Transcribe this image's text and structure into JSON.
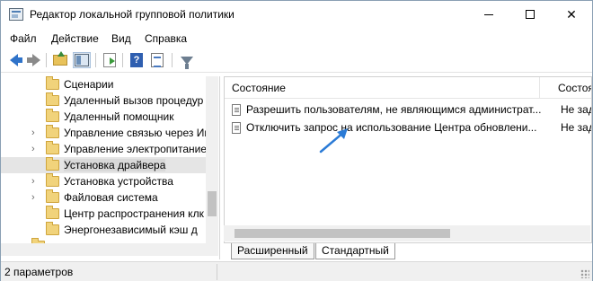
{
  "window": {
    "title": "Редактор локальной групповой политики",
    "min_glyph": "",
    "close_glyph": "✕"
  },
  "menu": {
    "items": [
      "Файл",
      "Действие",
      "Вид",
      "Справка"
    ]
  },
  "toolbar": {
    "icons": [
      "back-icon",
      "forward-icon",
      "up-folder-icon",
      "show-hide-tree-icon",
      "export-list-icon",
      "help-icon",
      "properties-icon",
      "filter-icon"
    ],
    "help_glyph": "?"
  },
  "tree": {
    "items": [
      {
        "label": "Сценарии",
        "expandable": false,
        "selected": false
      },
      {
        "label": "Удаленный вызов процедур",
        "expandable": false,
        "selected": false
      },
      {
        "label": "Удаленный помощник",
        "expandable": false,
        "selected": false
      },
      {
        "label": "Управление связью через Инт",
        "expandable": true,
        "selected": false
      },
      {
        "label": "Управление электропитание",
        "expandable": true,
        "selected": false
      },
      {
        "label": "Установка драйвера",
        "expandable": false,
        "selected": true
      },
      {
        "label": "Установка устройства",
        "expandable": true,
        "selected": false
      },
      {
        "label": "Файловая система",
        "expandable": true,
        "selected": false
      },
      {
        "label": "Центр распространения клк",
        "expandable": false,
        "selected": false
      },
      {
        "label": "Энергонезависимый кэш д",
        "expandable": false,
        "selected": false
      }
    ],
    "chevron_glyph": "›"
  },
  "list": {
    "columns": [
      "Состояние",
      "Состоя"
    ],
    "rows": [
      {
        "name": "Разрешить пользователям, не являющимся администрат...",
        "state": "Не зад"
      },
      {
        "name": "Отключить запрос на использование Центра обновлени...",
        "state": "Не зад"
      }
    ]
  },
  "tabs": [
    "Расширенный",
    "Стандартный"
  ],
  "status": {
    "text": "2 параметров"
  },
  "colors": {
    "annotation_arrow": "#2b7bd6",
    "selection": "#e5e5e5"
  }
}
